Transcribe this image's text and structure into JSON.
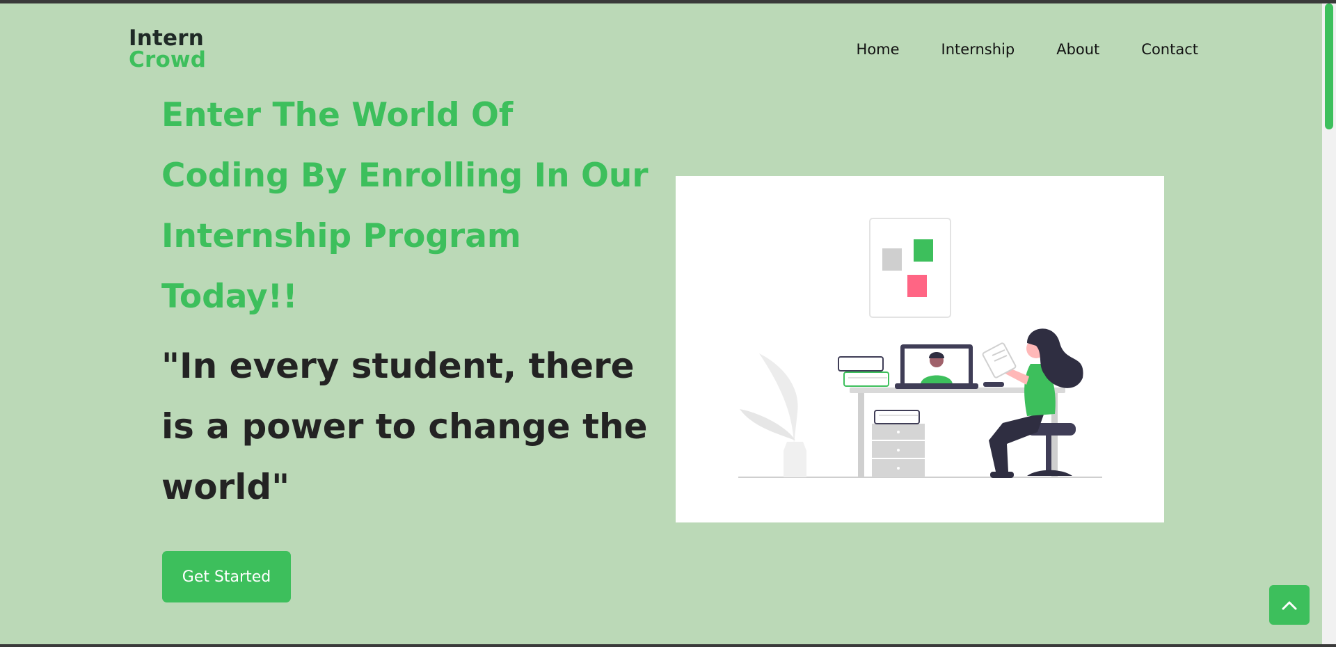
{
  "brand": {
    "line1": "Intern",
    "line2": "Crowd"
  },
  "nav": {
    "items": [
      {
        "label": "Home"
      },
      {
        "label": "Internship"
      },
      {
        "label": "About"
      },
      {
        "label": "Contact"
      }
    ]
  },
  "hero": {
    "headline": "Enter The World Of Coding By Enrolling In Our Internship Program Today!!",
    "quote": "\"In every student, there is a power to change the world\"",
    "cta_label": "Get Started"
  },
  "colors": {
    "background": "#bbd9b7",
    "accent": "#3dbf5c",
    "heading_dark": "#232323"
  },
  "icons": {
    "back_to_top": "chevron-up-icon"
  }
}
